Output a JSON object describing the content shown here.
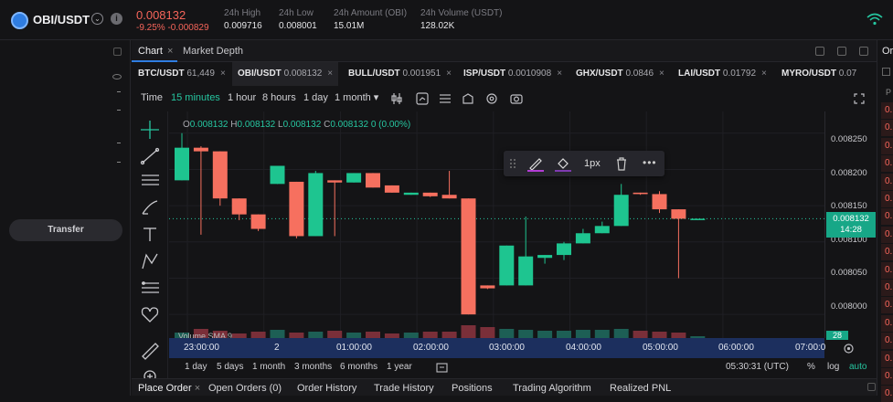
{
  "header": {
    "pair": "OBI/USDT",
    "last_price": "0.008132",
    "change": "-9.25% -0.000829",
    "stats": [
      {
        "label": "24h High",
        "value": "0.009716"
      },
      {
        "label": "24h Low",
        "value": "0.008001"
      },
      {
        "label": "24h Amount (OBI)",
        "value": "15.01M"
      },
      {
        "label": "24h Volume (USDT)",
        "value": "128.02K"
      }
    ]
  },
  "left": {
    "transfer_label": "Transfer"
  },
  "panel_tabs": {
    "chart": "Chart",
    "close": "×",
    "depth": "Market Depth"
  },
  "pair_tabs": [
    {
      "name": "BTC/USDT",
      "price": "61,449"
    },
    {
      "name": "OBI/USDT",
      "price": "0.008132"
    },
    {
      "name": "BULL/USDT",
      "price": "0.001951"
    },
    {
      "name": "ISP/USDT",
      "price": "0.0010908"
    },
    {
      "name": "GHX/USDT",
      "price": "0.0846"
    },
    {
      "name": "LAI/USDT",
      "price": "0.01792"
    },
    {
      "name": "MYRO/USDT",
      "price": "0.07"
    }
  ],
  "timeframes": {
    "time": "Time",
    "items": [
      "15 minutes",
      "1 hour",
      "8 hours",
      "1 day",
      "1 month ▾"
    ]
  },
  "ohlc": {
    "o": "0.008132",
    "h": "0.008132",
    "l": "0.008132",
    "c": "0.008132",
    "chg": "0 (0.00%)"
  },
  "drawing_toolbar": {
    "width_label": "1px"
  },
  "volume_label": "Volume SMA 9",
  "volume_value": "28",
  "y_axis": {
    "ticks": [
      "0.008250",
      "0.008200",
      "0.008150",
      "0.008100",
      "0.008050",
      "0.008000"
    ],
    "current_price": "0.008132",
    "countdown": "14:28"
  },
  "x_axis": [
    "23:00:00",
    "2",
    "01:00:00",
    "02:00:00",
    "03:00:00",
    "04:00:00",
    "05:00:00",
    "06:00:00",
    "07:00:0"
  ],
  "ranges": [
    "1 day",
    "5 days",
    "1 month",
    "3 months",
    "6 months",
    "1 year"
  ],
  "clock": "05:30:31 (UTC)",
  "scale_opts": [
    "%",
    "log",
    "auto"
  ],
  "order_tabs": [
    "Place Order",
    "Open Orders (0)",
    "Order History",
    "Trade History",
    "Positions",
    "Trading Algorithm",
    "Realized PNL"
  ],
  "right_panel": {
    "title": "Or",
    "header": "P",
    "cells": [
      "0.",
      "0.",
      "0.",
      "0.",
      "0.",
      "0.",
      "0.",
      "0.",
      "0.",
      "0.",
      "0.",
      "0.",
      "0.",
      "0.",
      "0.",
      "0.",
      "0."
    ]
  },
  "chart_data": {
    "type": "candlestick",
    "ylim": [
      0.00798,
      0.00828
    ],
    "candles": [
      {
        "o": 0.008185,
        "h": 0.00825,
        "l": 0.008185,
        "c": 0.00823
      },
      {
        "o": 0.00823,
        "h": 0.008232,
        "l": 0.00811,
        "c": 0.008225
      },
      {
        "o": 0.008225,
        "h": 0.008225,
        "l": 0.00815,
        "c": 0.00816
      },
      {
        "o": 0.00816,
        "h": 0.00816,
        "l": 0.00813,
        "c": 0.008138
      },
      {
        "o": 0.008138,
        "h": 0.008138,
        "l": 0.008115,
        "c": 0.008118
      },
      {
        "o": 0.00818,
        "h": 0.0082,
        "l": 0.00818,
        "c": 0.008205
      },
      {
        "o": 0.008183,
        "h": 0.008183,
        "l": 0.008105,
        "c": 0.008108
      },
      {
        "o": 0.008108,
        "h": 0.008198,
        "l": 0.008108,
        "c": 0.008195
      },
      {
        "o": 0.008185,
        "h": 0.008185,
        "l": 0.008108,
        "c": 0.008182
      },
      {
        "o": 0.008182,
        "h": 0.008195,
        "l": 0.008182,
        "c": 0.008195
      },
      {
        "o": 0.008195,
        "h": 0.008195,
        "l": 0.008175,
        "c": 0.008175
      },
      {
        "o": 0.008178,
        "h": 0.008178,
        "l": 0.008168,
        "c": 0.008168
      },
      {
        "o": 0.008165,
        "h": 0.008168,
        "l": 0.008165,
        "c": 0.008168
      },
      {
        "o": 0.008168,
        "h": 0.008168,
        "l": 0.008162,
        "c": 0.008163
      },
      {
        "o": 0.008165,
        "h": 0.008198,
        "l": 0.00816,
        "c": 0.00816
      },
      {
        "o": 0.00816,
        "h": 0.00816,
        "l": 0.008,
        "c": 0.008
      },
      {
        "o": 0.00804,
        "h": 0.00804,
        "l": 0.008035,
        "c": 0.008036
      },
      {
        "o": 0.00804,
        "h": 0.008095,
        "l": 0.00804,
        "c": 0.008095
      },
      {
        "o": 0.00804,
        "h": 0.008135,
        "l": 0.00804,
        "c": 0.00808
      },
      {
        "o": 0.008078,
        "h": 0.008082,
        "l": 0.00807,
        "c": 0.008082
      },
      {
        "o": 0.008082,
        "h": 0.0081,
        "l": 0.008075,
        "c": 0.008098
      },
      {
        "o": 0.008098,
        "h": 0.008118,
        "l": 0.008098,
        "c": 0.008112
      },
      {
        "o": 0.008112,
        "h": 0.008128,
        "l": 0.008112,
        "c": 0.008122
      },
      {
        "o": 0.008122,
        "h": 0.00818,
        "l": 0.008122,
        "c": 0.008165
      },
      {
        "o": 0.008168,
        "h": 0.008168,
        "l": 0.008165,
        "c": 0.008166
      },
      {
        "o": 0.008166,
        "h": 0.00817,
        "l": 0.00814,
        "c": 0.008145
      },
      {
        "o": 0.008145,
        "h": 0.008145,
        "l": 0.00805,
        "c": 0.008132
      },
      {
        "o": 0.008132,
        "h": 0.008132,
        "l": 0.00813,
        "c": 0.008132
      }
    ],
    "volumes": [
      6,
      10,
      8,
      5,
      7,
      9,
      6,
      7,
      8,
      6,
      7,
      5,
      6,
      7,
      7,
      14,
      12,
      10,
      9,
      8,
      8,
      9,
      9,
      10,
      8,
      7,
      6,
      2
    ]
  }
}
